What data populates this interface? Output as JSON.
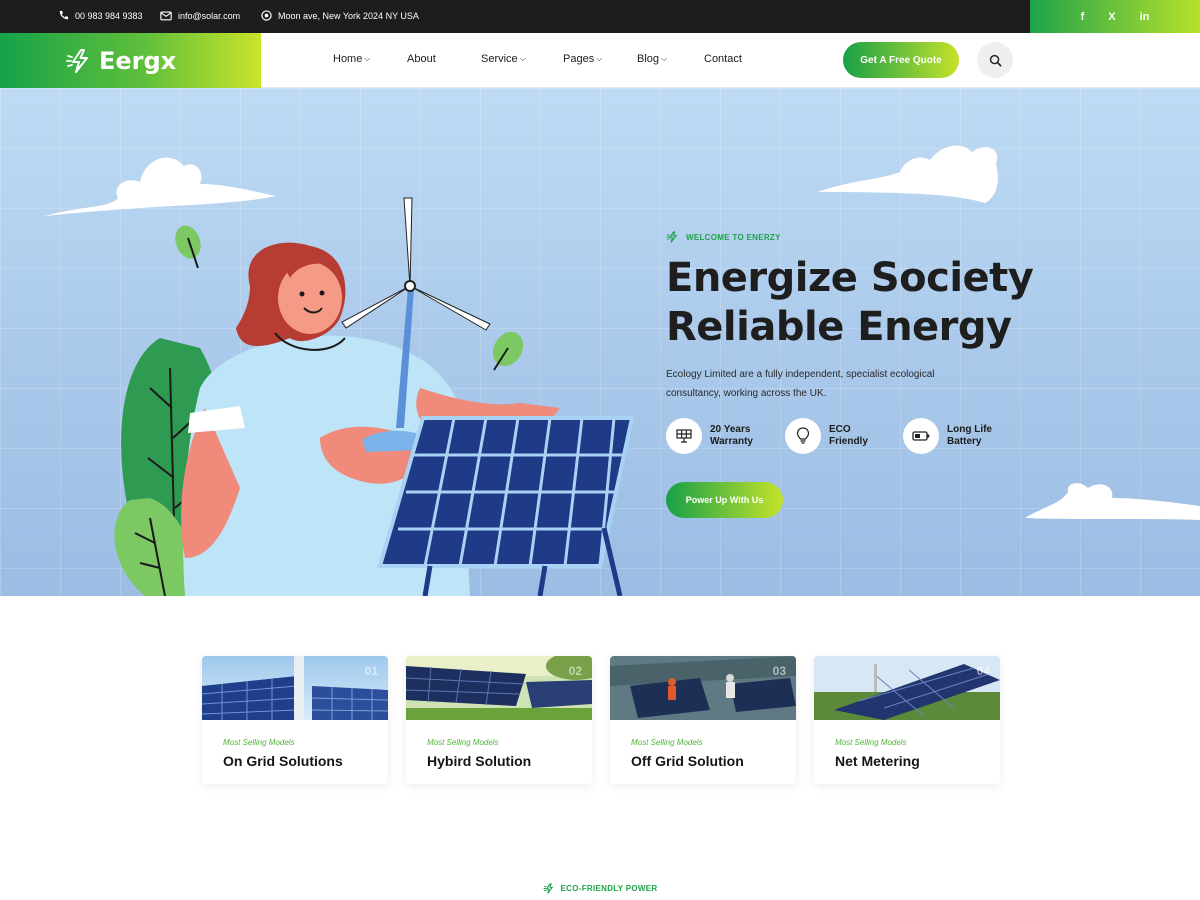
{
  "topbar": {
    "phone": "00 983 984 9383",
    "email": "info@solar.com",
    "address": "Moon ave, New York 2024 NY USA",
    "social": [
      "f",
      "X",
      "in"
    ]
  },
  "header": {
    "logo": "Eergx",
    "nav": [
      "Home",
      "About",
      "Service",
      "Pages",
      "Blog",
      "Contact"
    ],
    "cta": "Get A Free Quote"
  },
  "hero": {
    "tagline": "WELCOME TO ENERZY",
    "title_line1": "Energize Society",
    "title_line2": "Reliable Energy",
    "description_line1": "Ecology Limited are a fully independent, specialist ecological",
    "description_line2": "consultancy, working across the UK.",
    "features": [
      {
        "line1": "20 Years",
        "line2": "Warranty",
        "icon": "solar-panel-icon"
      },
      {
        "line1": "ECO",
        "line2": "Friendly",
        "icon": "bulb-icon"
      },
      {
        "line1": "Long Life",
        "line2": "Battery",
        "icon": "battery-icon"
      }
    ],
    "button": "Power Up With Us"
  },
  "cards": [
    {
      "num": "01",
      "subtitle": "Most Selling Models",
      "title": "On Grid Solutions"
    },
    {
      "num": "02",
      "subtitle": "Most Selling Models",
      "title": "Hybird Solution"
    },
    {
      "num": "03",
      "subtitle": "Most Selling Models",
      "title": "Off Grid Solution"
    },
    {
      "num": "04",
      "subtitle": "Most Selling Models",
      "title": "Net Metering"
    }
  ],
  "section_tag": "ECO-FRIENDLY POWER",
  "colors": {
    "brand_green": "#1fa34a",
    "brand_lime": "#c5e22b",
    "dark": "#1d1d1d"
  }
}
